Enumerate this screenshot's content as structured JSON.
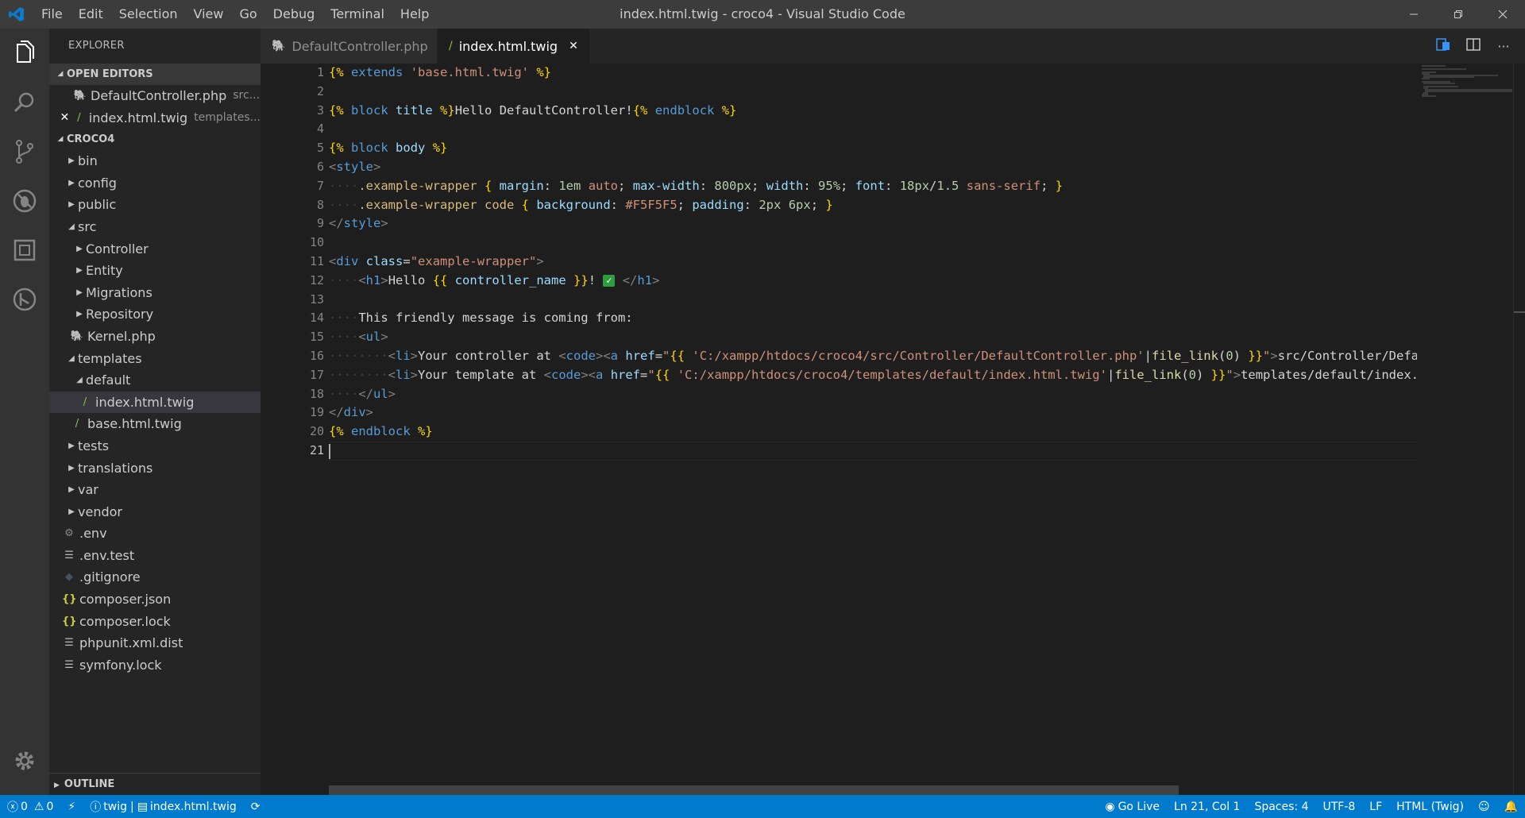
{
  "window": {
    "title": "index.html.twig - croco4 - Visual Studio Code",
    "menu": [
      "File",
      "Edit",
      "Selection",
      "View",
      "Go",
      "Debug",
      "Terminal",
      "Help"
    ]
  },
  "sidebar": {
    "title": "EXPLORER",
    "open_editors_label": "OPEN EDITORS",
    "open_editors": [
      {
        "name": "DefaultController.php",
        "desc": "src..."
      },
      {
        "name": "index.html.twig",
        "desc": "templates..."
      }
    ],
    "project_label": "CROCO4",
    "tree": [
      {
        "label": "bin"
      },
      {
        "label": "config"
      },
      {
        "label": "public"
      },
      {
        "label": "src"
      },
      {
        "label": "Controller"
      },
      {
        "label": "Entity"
      },
      {
        "label": "Migrations"
      },
      {
        "label": "Repository"
      },
      {
        "label": "Kernel.php"
      },
      {
        "label": "templates"
      },
      {
        "label": "default"
      },
      {
        "label": "index.html.twig"
      },
      {
        "label": "base.html.twig"
      },
      {
        "label": "tests"
      },
      {
        "label": "translations"
      },
      {
        "label": "var"
      },
      {
        "label": "vendor"
      },
      {
        "label": ".env"
      },
      {
        "label": ".env.test"
      },
      {
        "label": ".gitignore"
      },
      {
        "label": "composer.json"
      },
      {
        "label": "composer.lock"
      },
      {
        "label": "phpunit.xml.dist"
      },
      {
        "label": "symfony.lock"
      }
    ],
    "outline_label": "OUTLINE"
  },
  "tabs": [
    {
      "label": "DefaultController.php",
      "active": false
    },
    {
      "label": "index.html.twig",
      "active": true
    }
  ],
  "editor": {
    "line_numbers": [
      "1",
      "2",
      "3",
      "4",
      "5",
      "6",
      "7",
      "8",
      "9",
      "10",
      "11",
      "12",
      "13",
      "14",
      "15",
      "16",
      "17",
      "18",
      "19",
      "20",
      "21"
    ],
    "current_line": 21
  },
  "status": {
    "errors": "0",
    "warnings": "0",
    "branch": "twig",
    "file": "index.html.twig",
    "go_live": "Go Live",
    "position": "Ln 21, Col 1",
    "spaces": "Spaces: 4",
    "encoding": "UTF-8",
    "eol": "LF",
    "language": "HTML (Twig)"
  },
  "colors": {
    "accent": "#007acc",
    "titlebar": "#3c3c3c",
    "sidebar": "#252526",
    "editor": "#1e1e1e",
    "activitybar": "#333333"
  }
}
